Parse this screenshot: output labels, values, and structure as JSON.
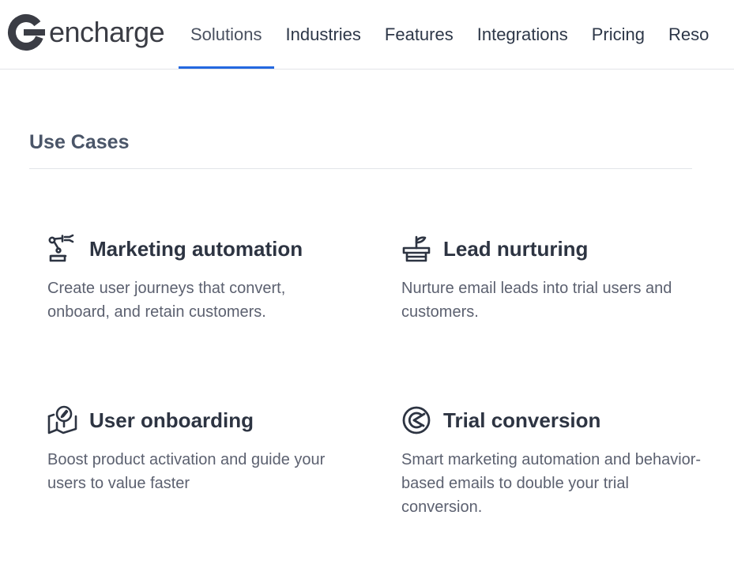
{
  "brand": {
    "name": "encharge",
    "logo_icon": "encharge-logo-icon"
  },
  "nav": {
    "items": [
      {
        "label": "Solutions",
        "active": true
      },
      {
        "label": "Industries",
        "active": false
      },
      {
        "label": "Features",
        "active": false
      },
      {
        "label": "Integrations",
        "active": false
      },
      {
        "label": "Pricing",
        "active": false
      },
      {
        "label": "Reso",
        "active": false
      }
    ],
    "active_color": "#2468e0"
  },
  "use_cases": {
    "title": "Use Cases",
    "cards": [
      {
        "icon": "robot-arm-icon",
        "title": "Marketing automation",
        "description": "Create user journeys that convert, onboard, and retain customers."
      },
      {
        "icon": "plant-pot-icon",
        "title": "Lead nurturing",
        "description": "Nurture email leads into trial users and customers."
      },
      {
        "icon": "map-compass-icon",
        "title": "User onboarding",
        "description": "Boost product activation and guide your users to value faster"
      },
      {
        "icon": "target-arrow-icon",
        "title": "Trial conversion",
        "description": "Smart marketing automation and behavior-based emails to double your trial conversion."
      }
    ]
  }
}
